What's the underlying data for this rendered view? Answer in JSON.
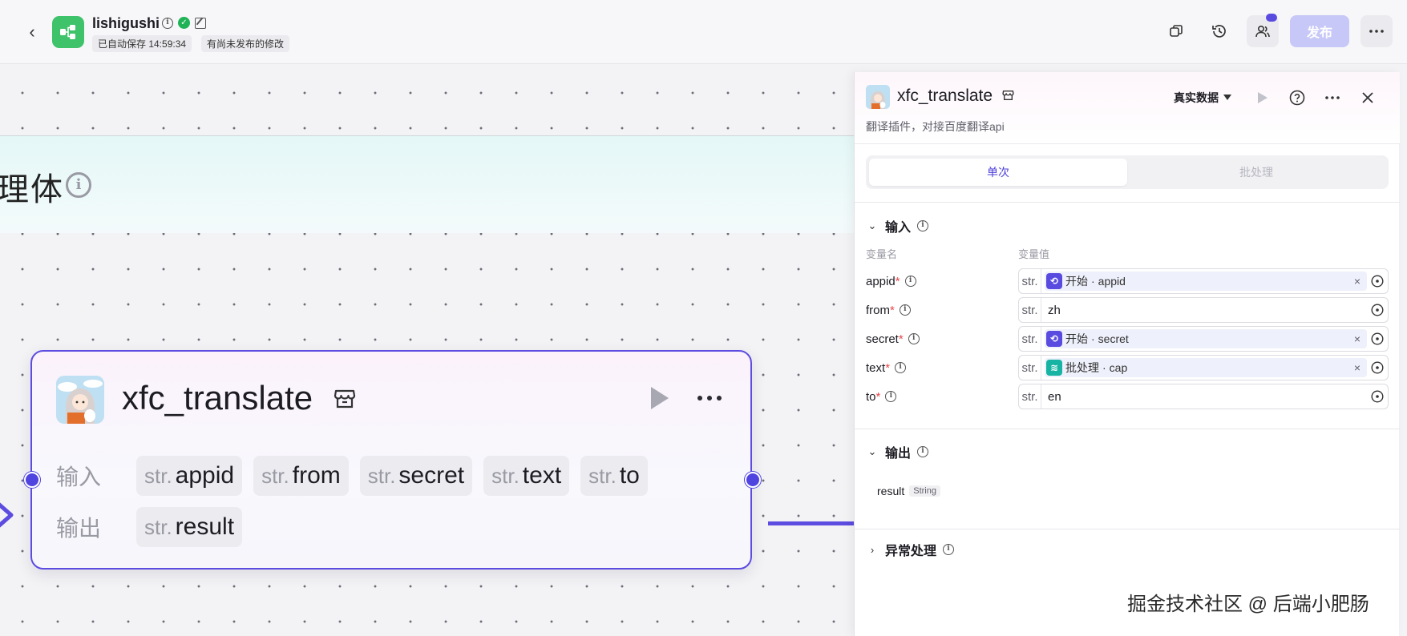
{
  "header": {
    "app_name": "lishigushi",
    "autosave": "已自动保存 14:59:34",
    "unpublished": "有尚未发布的修改",
    "publish_label": "发布"
  },
  "canvas": {
    "group_title": "理体",
    "node": {
      "title": "xfc_translate",
      "input_label": "输入",
      "output_label": "输出",
      "inputs": [
        {
          "type": "str.",
          "name": "appid"
        },
        {
          "type": "str.",
          "name": "from"
        },
        {
          "type": "str.",
          "name": "secret"
        },
        {
          "type": "str.",
          "name": "text"
        },
        {
          "type": "str.",
          "name": "to"
        }
      ],
      "outputs": [
        {
          "type": "str.",
          "name": "result"
        }
      ]
    }
  },
  "panel": {
    "title": "xfc_translate",
    "description": "翻译插件，对接百度翻译api",
    "data_mode": "真实数据",
    "tabs": {
      "single": "单次",
      "batch": "批处理"
    },
    "input_section": "输入",
    "col_name": "变量名",
    "col_value": "变量值",
    "params": [
      {
        "name": "appid",
        "type": "str.",
        "kind": "ref",
        "source": "开始",
        "field": "appid",
        "icon_color": "#5a4be0"
      },
      {
        "name": "from",
        "type": "str.",
        "kind": "literal",
        "value": "zh"
      },
      {
        "name": "secret",
        "type": "str.",
        "kind": "ref",
        "source": "开始",
        "field": "secret",
        "icon_color": "#5a4be0"
      },
      {
        "name": "text",
        "type": "str.",
        "kind": "ref",
        "source": "批处理",
        "field": "cap",
        "icon_color": "#17b3a3"
      },
      {
        "name": "to",
        "type": "str.",
        "kind": "literal",
        "value": "en"
      }
    ],
    "output_section": "输出",
    "output": {
      "name": "result",
      "type": "String"
    },
    "error_section": "异常处理"
  },
  "watermark": "掘金技术社区 @ 后端小肥肠",
  "colors": {
    "accent": "#5c4ce0",
    "publish_disabled": "#c7c8f7",
    "required": "#e5484d"
  }
}
